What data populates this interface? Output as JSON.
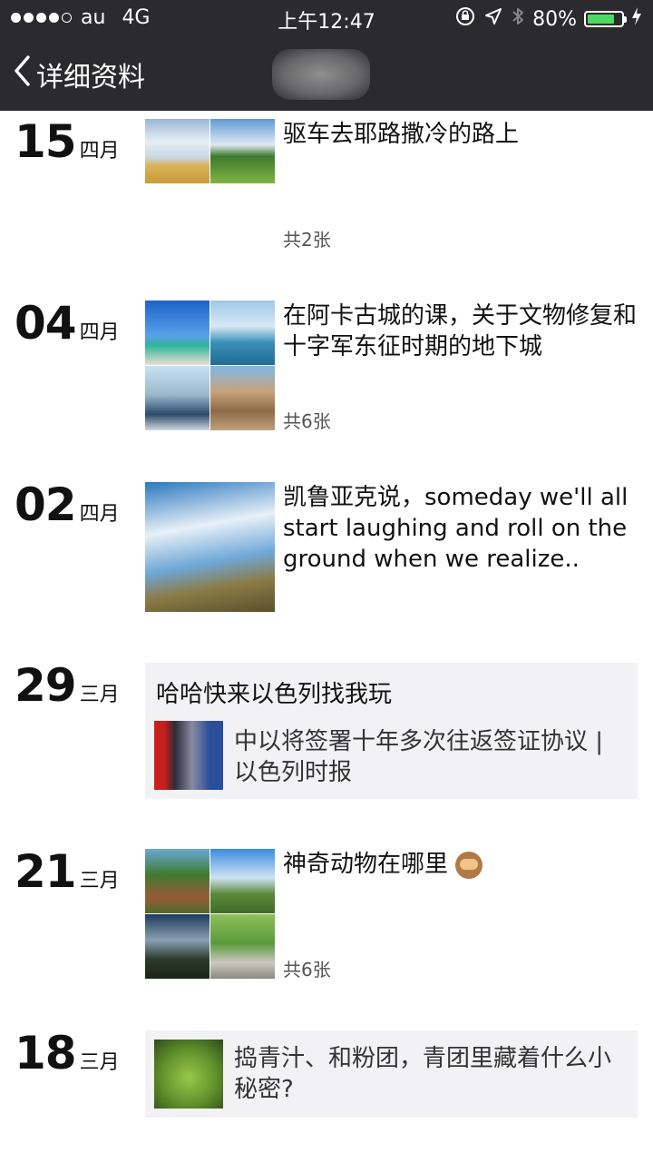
{
  "status_bar": {
    "carrier": "au",
    "network": "4G",
    "time": "上午12:47",
    "battery": "80%",
    "battery_level": 0.8
  },
  "nav": {
    "back_label": "详细资料"
  },
  "entries": [
    {
      "day": "15",
      "month": "四月",
      "caption": "驱车去耶路撒冷的路上",
      "count": "共2张"
    },
    {
      "day": "04",
      "month": "四月",
      "caption": "在阿卡古城的课，关于文物修复和十字军东征时期的地下城",
      "count": "共6张"
    },
    {
      "day": "02",
      "month": "四月",
      "caption": "凯鲁亚克说，someday we'll all start laughing and roll on the ground when we realize.."
    },
    {
      "day": "29",
      "month": "三月",
      "share_title": "哈哈快来以色列找我玩",
      "share_text": "中以将签署十年多次往返签证协议 | 以色列时报"
    },
    {
      "day": "21",
      "month": "三月",
      "caption": "神奇动物在哪里",
      "caption_emoji": "see-no-evil-monkey",
      "count": "共6张"
    },
    {
      "day": "18",
      "month": "三月",
      "share_text": "捣青汁、和粉团，青团里藏着什么小秘密?"
    }
  ]
}
